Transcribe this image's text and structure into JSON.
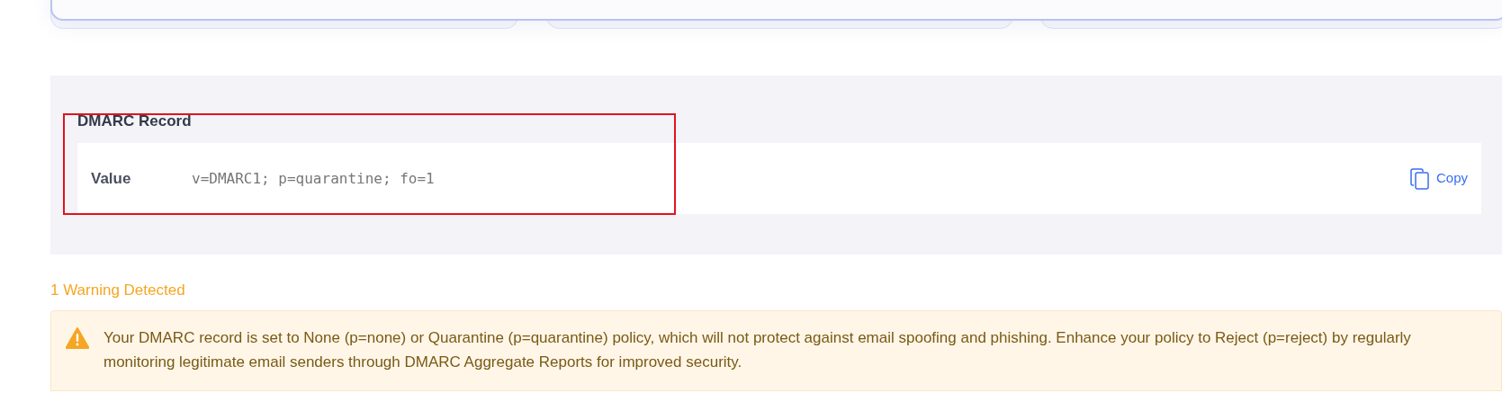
{
  "dmarc_record": {
    "title": "DMARC Record",
    "label": "Value",
    "value": "v=DMARC1; p=quarantine; fo=1",
    "copy_button": "Copy"
  },
  "warnings": {
    "heading": "1 Warning Detected",
    "items": [
      {
        "text": "Your DMARC record is set to None (p=none) or Quarantine (p=quarantine) policy, which will not protect against email spoofing and phishing. Enhance your policy to Reject (p=reject) by regularly monitoring legitimate email senders through DMARC Aggregate Reports for improved security."
      }
    ]
  }
}
